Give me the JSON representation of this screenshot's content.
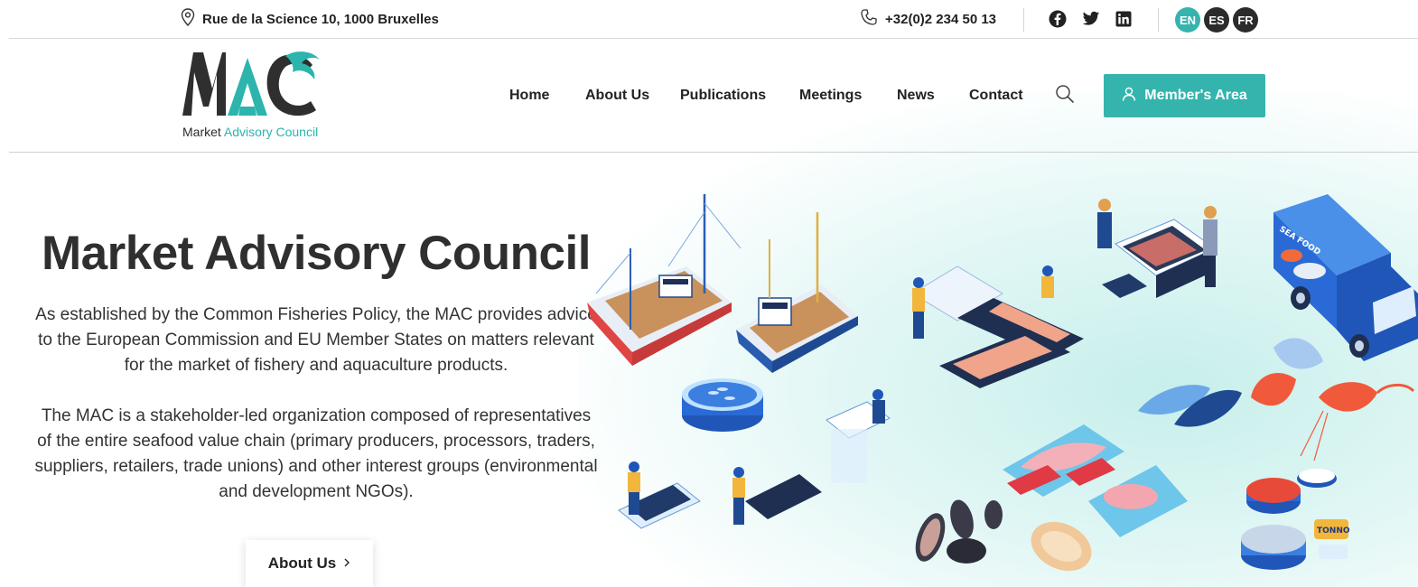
{
  "topbar": {
    "address": "Rue de la Science 10, 1000 Bruxelles",
    "phone": "+32(0)2 234 50 13",
    "social": [
      "facebook-icon",
      "twitter-icon",
      "linkedin-icon"
    ],
    "languages": [
      {
        "code": "EN",
        "active": true
      },
      {
        "code": "ES",
        "active": false
      },
      {
        "code": "FR",
        "active": false
      }
    ]
  },
  "logo": {
    "caption_part1": "Market",
    "caption_part2": "Advisory Council"
  },
  "nav": {
    "items": [
      "Home",
      "About Us",
      "Publications",
      "Meetings",
      "News",
      "Contact"
    ],
    "member_button": "Member's Area"
  },
  "hero": {
    "title": "Market Advisory Council",
    "paragraph1": "As established by the Common Fisheries Policy, the MAC provides advice to the European Commission and EU Member States on matters relevant for the market of fishery and aquaculture products.",
    "paragraph2": "The MAC is a stakeholder-led organization composed of representatives of the entire seafood value chain (primary producers, processors, traders, suppliers, retailers, trade unions) and other interest groups (environmental and development NGOs).",
    "button": "About Us",
    "illustration_labels": [
      "SEA FOOD",
      "TONNO"
    ]
  },
  "colors": {
    "accent": "#35b4ae",
    "dark": "#2f2f2f",
    "lang_active": "#35b4ae",
    "lang_inactive": "#2b2b2b"
  }
}
